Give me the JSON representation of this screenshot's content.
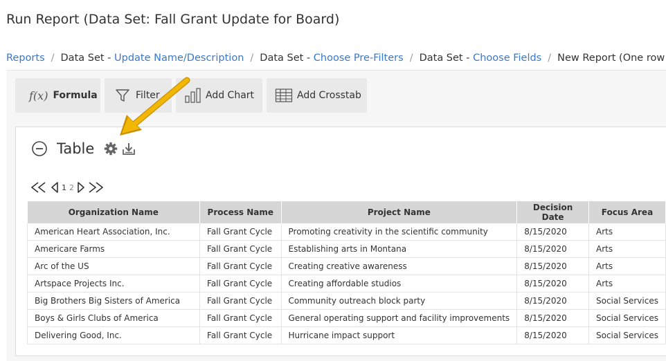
{
  "page": {
    "title": "Run Report (Data Set: Fall Grant Update for Board)"
  },
  "breadcrumb": {
    "items": [
      {
        "prefix": "",
        "link": "Reports"
      },
      {
        "prefix": "Data Set - ",
        "link": "Update Name/Description"
      },
      {
        "prefix": "Data Set - ",
        "link": "Choose Pre-Filters"
      },
      {
        "prefix": "Data Set - ",
        "link": "Choose Fields"
      }
    ],
    "current": "New Report (One row p"
  },
  "toolbar": {
    "formula_icon": "f(x)",
    "formula_label": "Formula",
    "filter_label": "Filter",
    "chart_label": "Add Chart",
    "crosstab_label": "Add Crosstab"
  },
  "table_section": {
    "title": "Table"
  },
  "pager": {
    "pages": [
      "1",
      "2"
    ],
    "current": "1"
  },
  "grid": {
    "columns": [
      "Organization Name",
      "Process Name",
      "Project Name",
      "Decision Date",
      "Focus Area"
    ],
    "rows": [
      [
        "American Heart Association, Inc.",
        "Fall Grant Cycle",
        "Promoting creativity in the scientific community",
        "8/15/2020",
        "Arts"
      ],
      [
        "Americare Farms",
        "Fall Grant Cycle",
        "Establishing arts in Montana",
        "8/15/2020",
        "Arts"
      ],
      [
        "Arc of the US",
        "Fall Grant Cycle",
        "Creating creative awareness",
        "8/15/2020",
        "Arts"
      ],
      [
        "Artspace Projects Inc.",
        "Fall Grant Cycle",
        "Creating affordable studios",
        "8/15/2020",
        "Arts"
      ],
      [
        "Big Brothers Big Sisters of America",
        "Fall Grant Cycle",
        "Community outreach block party",
        "8/15/2020",
        "Social Services"
      ],
      [
        "Boys & Girls Clubs of America",
        "Fall Grant Cycle",
        "General operating support and facility improvements",
        "8/15/2020",
        "Social Services"
      ],
      [
        "Delivering Good, Inc.",
        "Fall Grant Cycle",
        "Hurricane impact support",
        "8/15/2020",
        "Social Services"
      ]
    ]
  },
  "colors": {
    "link": "#3a78c9",
    "annotation_arrow": "#f0b400",
    "header_bg": "#d6d6d6"
  }
}
